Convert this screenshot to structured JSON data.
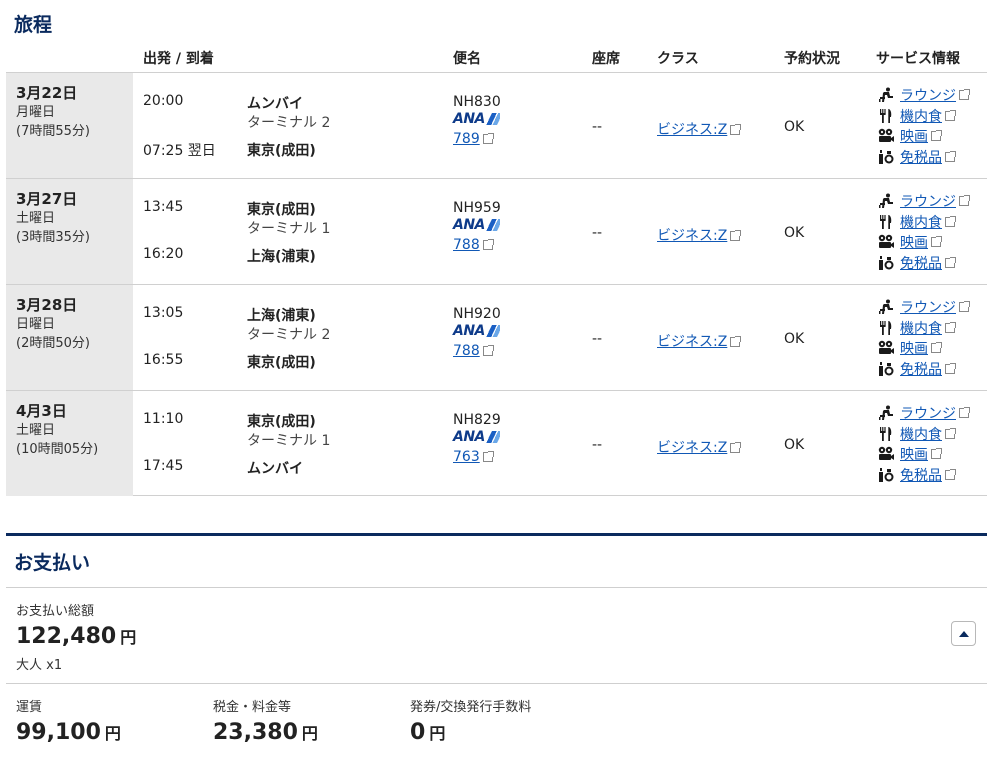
{
  "itinerary": {
    "title": "旅程",
    "headers": {
      "departure_arrival": "出発 / 到着",
      "flight": "便名",
      "seat": "座席",
      "class": "クラス",
      "status": "予約状況",
      "services": "サービス情報"
    },
    "services": {
      "lounge": "ラウンジ",
      "meal": "機内食",
      "movie": "映画",
      "dutyfree": "免税品"
    },
    "airline_logo_text": "ANA",
    "rows": [
      {
        "date": "3月22日",
        "weekday": "月曜日",
        "duration": "(7時間55分)",
        "dep_time": "20:00",
        "dep_city": "ムンバイ",
        "dep_terminal": "ターミナル 2",
        "arr_time": "07:25 翌日",
        "arr_city": "東京(成田)",
        "arr_terminal": "",
        "flight_no": "NH830",
        "aircraft": "789",
        "seat": "--",
        "class": "ビジネス:Z",
        "status": "OK"
      },
      {
        "date": "3月27日",
        "weekday": "土曜日",
        "duration": "(3時間35分)",
        "dep_time": "13:45",
        "dep_city": "東京(成田)",
        "dep_terminal": "ターミナル 1",
        "arr_time": "16:20",
        "arr_city": "上海(浦東)",
        "arr_terminal": "",
        "flight_no": "NH959",
        "aircraft": "788",
        "seat": "--",
        "class": "ビジネス:Z",
        "status": "OK"
      },
      {
        "date": "3月28日",
        "weekday": "日曜日",
        "duration": "(2時間50分)",
        "dep_time": "13:05",
        "dep_city": "上海(浦東)",
        "dep_terminal": "ターミナル 2",
        "arr_time": "16:55",
        "arr_city": "東京(成田)",
        "arr_terminal": "",
        "flight_no": "NH920",
        "aircraft": "788",
        "seat": "--",
        "class": "ビジネス:Z",
        "status": "OK"
      },
      {
        "date": "4月3日",
        "weekday": "土曜日",
        "duration": "(10時間05分)",
        "dep_time": "11:10",
        "dep_city": "東京(成田)",
        "dep_terminal": "ターミナル 1",
        "arr_time": "17:45",
        "arr_city": "ムンバイ",
        "arr_terminal": "",
        "flight_no": "NH829",
        "aircraft": "763",
        "seat": "--",
        "class": "ビジネス:Z",
        "status": "OK"
      }
    ]
  },
  "payment": {
    "title": "お支払い",
    "total_label": "お支払い総額",
    "total_amount": "122,480",
    "currency": "円",
    "passengers": "大人 x1",
    "breakdown": [
      {
        "label": "運賃",
        "amount": "99,100"
      },
      {
        "label": "税金・料金等",
        "amount": "23,380"
      },
      {
        "label": "発券/交換発行手数料",
        "amount": "0"
      }
    ]
  },
  "colors": {
    "navy": "#0a2a5e",
    "link": "#1158b5",
    "date_bg": "#e9e9e9"
  }
}
